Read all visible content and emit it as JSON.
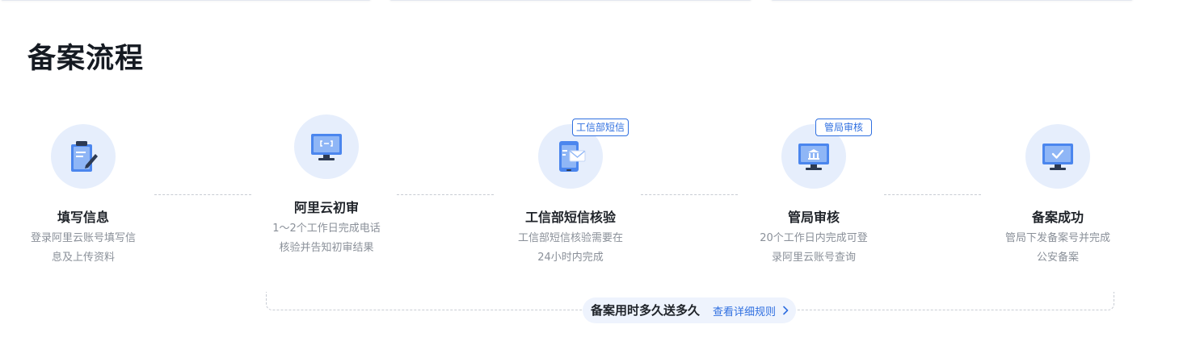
{
  "section": {
    "title": "备案流程"
  },
  "steps": [
    {
      "title": "填写信息",
      "desc": "登录阿里云账号填写信息及上传资料",
      "icon": "clipboard-pen-icon"
    },
    {
      "title": "阿里云初审",
      "desc": "1～2个工作日完成电话核验并告知初审结果",
      "icon": "monitor-icon"
    },
    {
      "title": "工信部短信核验",
      "desc": "工信部短信核验需要在24小时内完成",
      "tag": "工信部短信",
      "icon": "phone-message-icon"
    },
    {
      "title": "管局审核",
      "desc": "20个工作日内完成可登录阿里云账号查询",
      "tag": "管局审核",
      "icon": "monitor-bank-icon"
    },
    {
      "title": "备案成功",
      "desc": "管局下发备案号并完成公安备案",
      "icon": "monitor-check-icon"
    }
  ],
  "promo": {
    "text": "备案用时多久送多久",
    "link_label": "查看详细规则",
    "link_icon": "chevron-right-icon"
  },
  "colors": {
    "accent": "#2f6fe0",
    "circle_bg": "#e6eefc",
    "text_muted": "#8a9099",
    "title": "#151a22"
  }
}
